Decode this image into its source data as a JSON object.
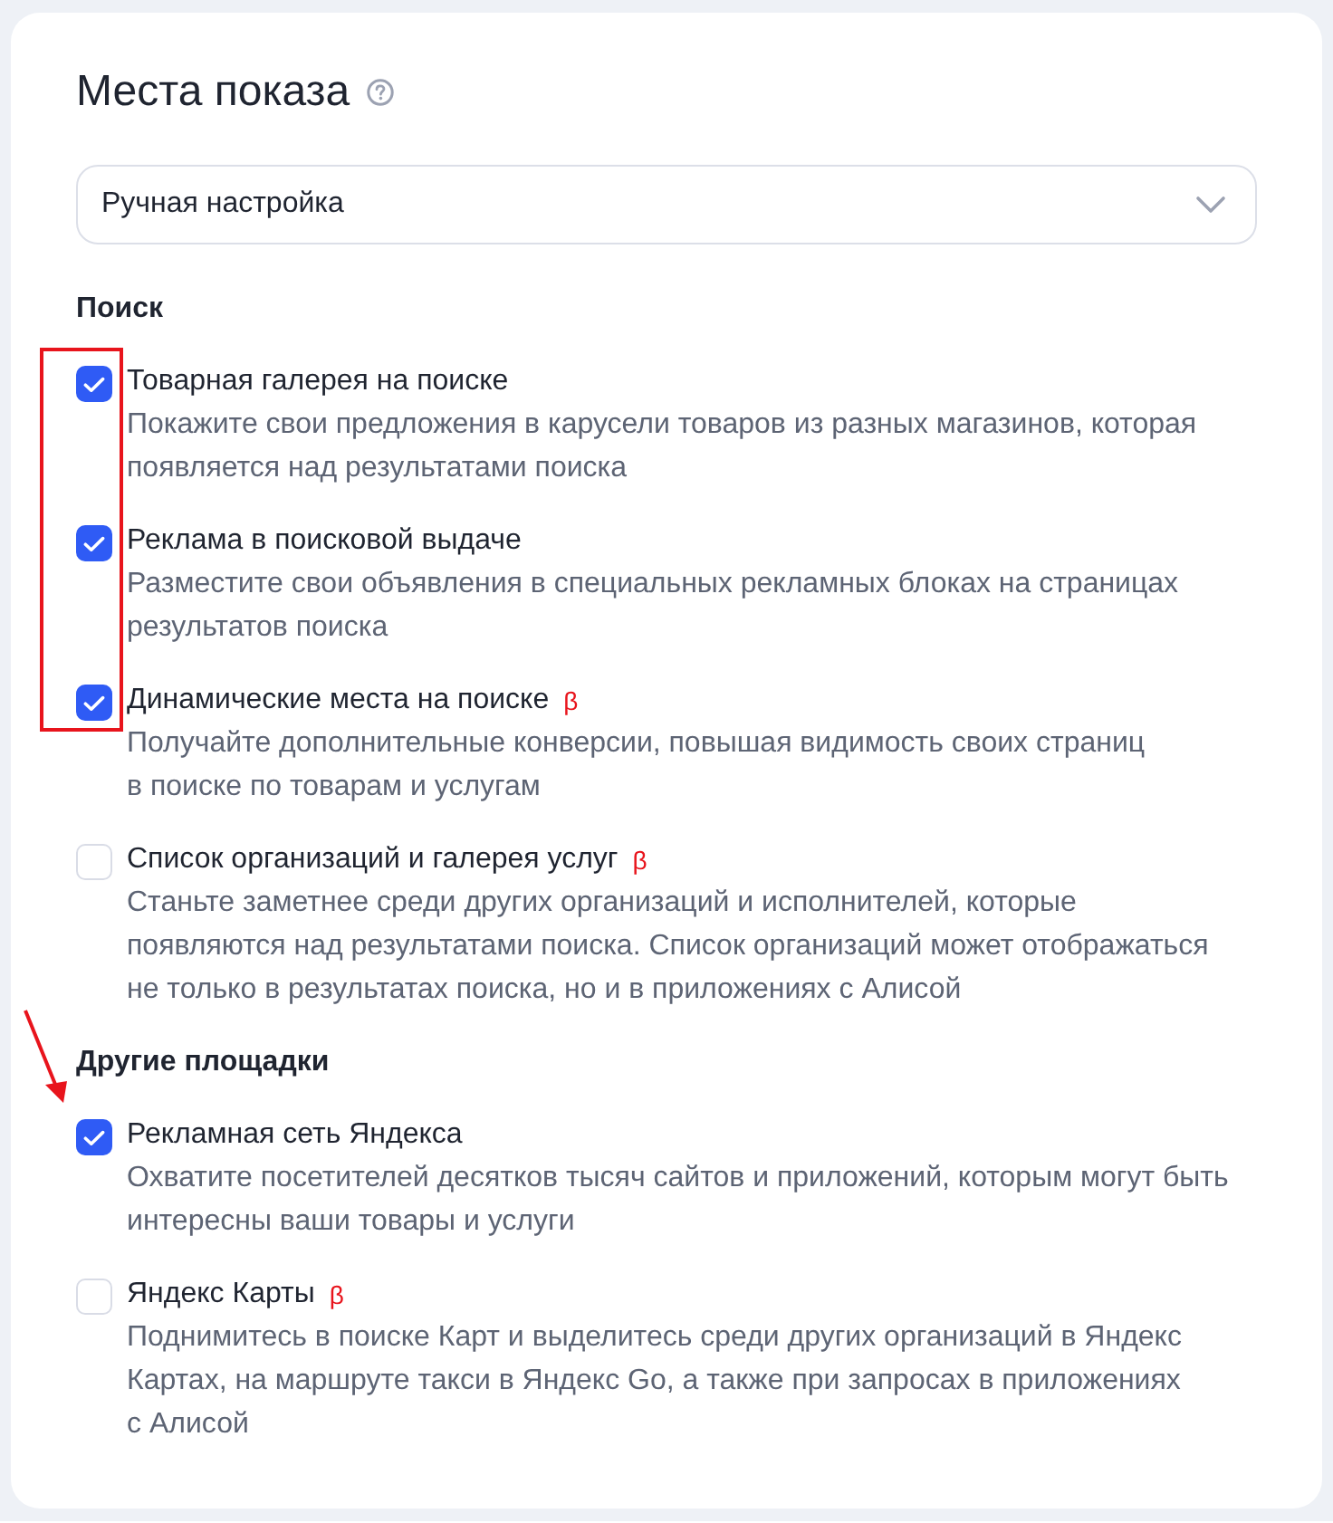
{
  "panel": {
    "title": "Места показа",
    "dropdown": {
      "value": "Ручная настройка"
    },
    "sections": [
      {
        "heading": "Поиск",
        "items": [
          {
            "title": "Товарная галерея на поиске",
            "checked": true,
            "description": "Покажите свои предложения в карусели товаров из разных магазинов, которая\nпоявляется над результатами поиска"
          },
          {
            "title": "Реклама в поисковой выдаче",
            "checked": true,
            "description": "Разместите свои объявления в специальных рекламных блоках на страницах\nрезультатов поиска"
          },
          {
            "title": "Динамические места на поиске",
            "badge": "β",
            "checked": true,
            "description": "Получайте дополнительные конверсии, повышая видимость своих страниц\nв поиске по товарам и услугам"
          },
          {
            "title": "Список организаций и галерея услуг",
            "badge": "β",
            "checked": false,
            "description": "Станьте заметнее среди других организаций и исполнителей, которые\nпоявляются над результатами поиска. Список организаций может отображаться\nне только в результатах поиска, но и в приложениях с Алисой"
          }
        ]
      },
      {
        "heading": "Другие площадки",
        "items": [
          {
            "title": "Рекламная сеть Яндекса",
            "checked": true,
            "description": "Охватите посетителей десятков тысяч сайтов и приложений, которым могут быть\nинтересны ваши товары и услуги"
          },
          {
            "title": "Яндекс Карты",
            "badge": "β",
            "checked": false,
            "description": "Поднимитесь в поиске Карт и выделитесь среди других организаций в Яндекс\nКартах, на маршруте такси в Яндекс Go, а также при запросах в приложениях\nс Алисой"
          }
        ]
      }
    ]
  },
  "annotations": [
    {
      "kind": "frame"
    },
    {
      "kind": "arrow"
    }
  ]
}
